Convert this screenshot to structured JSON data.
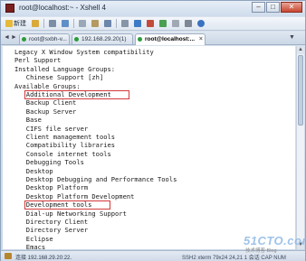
{
  "window": {
    "title": "root@localhost:~ - Xshell 4",
    "minimize_label": "–",
    "maximize_label": "□",
    "close_label": "✕"
  },
  "toolbar": {
    "new_label": "新建"
  },
  "tabs": [
    {
      "label": "root@sxbh-v..."
    },
    {
      "label": "192.168.29.20(1)"
    },
    {
      "label": "root@localhost:..."
    }
  ],
  "terminal": {
    "lines": [
      "Legacy X Window System compatibility",
      "Perl Support",
      "Installed Language Groups:",
      "   Chinese Support [zh]",
      "Available Groups:",
      "   Additional Development",
      "   Backup Client",
      "   Backup Server",
      "   Base",
      "   CIFS file server",
      "   Client management tools",
      "   Compatibility libraries",
      "   Console internet tools",
      "   Debugging Tools",
      "   Desktop",
      "   Desktop Debugging and Performance Tools",
      "   Desktop Platform",
      "   Desktop Platform Development",
      "   Development tools",
      "   Dial-up Networking Support",
      "   Directory Client",
      "   Directory Server",
      "   Eclipse",
      "   Emacs"
    ],
    "highlighted": [
      "Additional Development",
      "Development tools"
    ],
    "highlight_color": "#d23a3a"
  },
  "statusbar": {
    "connection": "连接 192.168.29.20:22.",
    "right": "SSH2   xterm   79x24   24,21   1 会话   CAP NUM"
  },
  "watermark": {
    "brand": "51CTO.com",
    "sub": "技术博客 Blog"
  }
}
